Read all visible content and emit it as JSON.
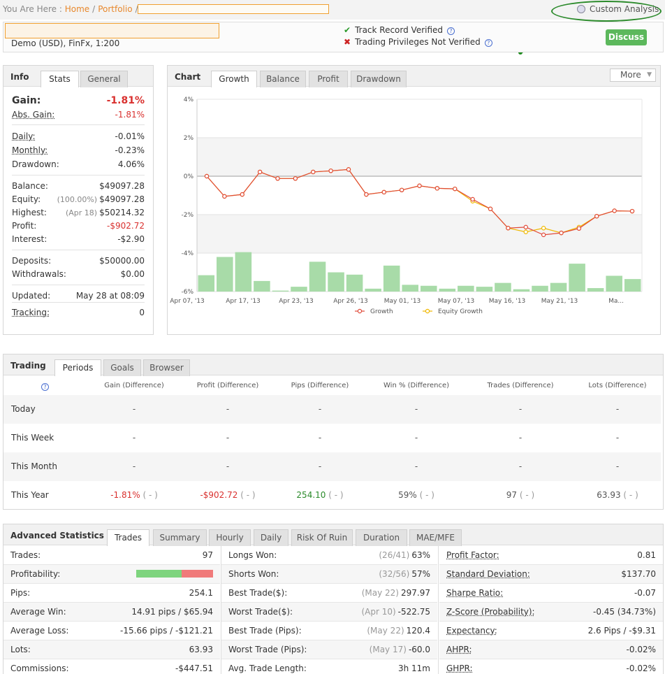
{
  "breadcrumb": {
    "prefix": "You Are Here :",
    "home": "Home",
    "portfolio": "Portfolio",
    "sep": "/"
  },
  "custom_analysis": "Custom Analysis",
  "account": {
    "info": "Demo (USD), FinFx, 1:200",
    "track_record": "Track Record Verified",
    "trading_privileges": "Trading Privileges Not Verified",
    "discuss_label": "Discuss",
    "help_glyph": "?"
  },
  "info_panel": {
    "title": "Info",
    "tabs": [
      "Stats",
      "General"
    ],
    "gain": {
      "label": "Gain:",
      "value": "-1.81%"
    },
    "abs_gain": {
      "label": "Abs. Gain:",
      "value": "-1.81%"
    },
    "daily": {
      "label": "Daily:",
      "value": "-0.01%"
    },
    "monthly": {
      "label": "Monthly:",
      "value": "-0.23%"
    },
    "drawdown": {
      "label": "Drawdown:",
      "value": "4.06%"
    },
    "balance": {
      "label": "Balance:",
      "value": "$49097.28"
    },
    "equity": {
      "label": "Equity:",
      "note": "(100.00%)",
      "value": "$49097.28"
    },
    "highest": {
      "label": "Highest:",
      "note": "(Apr 18)",
      "value": "$50214.32"
    },
    "profit": {
      "label": "Profit:",
      "value": "-$902.72"
    },
    "interest": {
      "label": "Interest:",
      "value": "-$2.90"
    },
    "deposits": {
      "label": "Deposits:",
      "value": "$50000.00"
    },
    "withdrawals": {
      "label": "Withdrawals:",
      "value": "$0.00"
    },
    "updated": {
      "label": "Updated:",
      "value": "May 28 at 08:09"
    },
    "tracking": {
      "label": "Tracking:",
      "value": "0"
    }
  },
  "chart_panel": {
    "title": "Chart",
    "tabs": [
      "Growth",
      "Balance",
      "Profit",
      "Drawdown"
    ],
    "more_label": "More"
  },
  "chart_data": {
    "type": "line",
    "y_ticks": [
      "4%",
      "2%",
      "0%",
      "-2%",
      "-4%",
      "-6%"
    ],
    "ylim": [
      -6,
      4
    ],
    "x_ticks": [
      "Apr 07, '13",
      "Apr 17, '13",
      "Apr 23, '13",
      "Apr 26, '13",
      "May 01, '13",
      "May 07, '13",
      "May 16, '13",
      "May 21, '13",
      "Ma..."
    ],
    "series": [
      {
        "name": "Growth",
        "color": "#e04a3a",
        "values": [
          0.0,
          -1.05,
          -0.95,
          0.22,
          -0.12,
          -0.12,
          0.22,
          0.28,
          0.35,
          -0.95,
          -0.83,
          -0.72,
          -0.5,
          -0.63,
          -0.66,
          -1.2,
          -1.7,
          -2.7,
          -2.65,
          -3.05,
          -2.95,
          -2.72,
          -2.08,
          -1.8,
          -1.82
        ]
      },
      {
        "name": "Equity Growth",
        "color": "#f0b800",
        "values": [
          0.0,
          -1.05,
          -0.95,
          0.22,
          -0.12,
          -0.12,
          0.22,
          0.28,
          0.35,
          -0.95,
          -0.83,
          -0.72,
          -0.5,
          -0.63,
          -0.66,
          -1.3,
          -1.7,
          -2.7,
          -2.9,
          -2.7,
          -2.95,
          -2.65,
          -2.08,
          -1.8,
          -1.82
        ]
      }
    ],
    "bars": [
      0.85,
      1.8,
      2.05,
      0.55,
      0.05,
      0.25,
      1.55,
      1.0,
      0.88,
      0.15,
      1.35,
      0.35,
      0.3,
      0.15,
      0.3,
      0.25,
      0.45,
      0.12,
      0.3,
      0.45,
      1.45,
      0.18,
      0.82,
      0.65
    ],
    "grid": true,
    "legend": "bottom"
  },
  "trading_panel": {
    "title": "Trading",
    "tabs": [
      "Periods",
      "Goals",
      "Browser"
    ],
    "headers": [
      "Gain (Difference)",
      "Profit (Difference)",
      "Pips (Difference)",
      "Win % (Difference)",
      "Trades (Difference)",
      "Lots (Difference)"
    ],
    "rows": [
      {
        "label": "Today",
        "cells": [
          "-",
          "-",
          "-",
          "-",
          "-",
          "-"
        ]
      },
      {
        "label": "This Week",
        "cells": [
          "-",
          "-",
          "-",
          "-",
          "-",
          "-"
        ]
      },
      {
        "label": "This Month",
        "cells": [
          "-",
          "-",
          "-",
          "-",
          "-",
          "-"
        ]
      },
      {
        "label": "This Year",
        "cells": [
          "-1.81%",
          "-$902.72",
          "254.10",
          "59%",
          "97",
          "63.93"
        ],
        "diff": "( - )"
      }
    ]
  },
  "advanced_panel": {
    "title": "Advanced Statistics",
    "tabs": [
      "Trades",
      "Summary",
      "Hourly",
      "Daily",
      "Risk Of Ruin",
      "Duration",
      "MAE/MFE"
    ],
    "col1": [
      {
        "label": "Trades:",
        "value": "97"
      },
      {
        "label": "Profitability:",
        "value": ""
      },
      {
        "label": "Pips:",
        "value": "254.1"
      },
      {
        "label": "Average Win:",
        "value": "14.91 pips / $65.94"
      },
      {
        "label": "Average Loss:",
        "value": "-15.66 pips / -$121.21"
      },
      {
        "label": "Lots:",
        "value": "63.93"
      },
      {
        "label": "Commissions:",
        "value": "-$447.51"
      }
    ],
    "profitability_win_fraction": 0.59,
    "col2": [
      {
        "label": "Longs Won:",
        "note": "(26/41)",
        "value": "63%"
      },
      {
        "label": "Shorts Won:",
        "note": "(32/56)",
        "value": "57%"
      },
      {
        "label": "Best Trade($):",
        "note": "(May 22)",
        "value": "297.97"
      },
      {
        "label": "Worst Trade($):",
        "note": "(Apr 10)",
        "value": "-522.75"
      },
      {
        "label": "Best Trade (Pips):",
        "note": "(May 22)",
        "value": "120.4"
      },
      {
        "label": "Worst Trade (Pips):",
        "note": "(May 17)",
        "value": "-60.0"
      },
      {
        "label": "Avg. Trade Length:",
        "note": "",
        "value": "3h 11m"
      }
    ],
    "col3": [
      {
        "label": "Profit Factor:",
        "value": "0.81"
      },
      {
        "label": "Standard Deviation:",
        "value": "$137.70"
      },
      {
        "label": "Sharpe Ratio:",
        "value": "-0.07"
      },
      {
        "label": "Z-Score (Probability):",
        "value": "-0.45 (34.73%)"
      },
      {
        "label": "Expectancy:",
        "value": "2.6 Pips / -$9.31"
      },
      {
        "label": "AHPR:",
        "value": "-0.02%"
      },
      {
        "label": "GHPR:",
        "value": "-0.02%"
      }
    ]
  },
  "colors": {
    "accent_orange": "#e8882c",
    "negative": "#d9312f",
    "positive": "#2a8a2a",
    "discuss_green": "#5cb85c",
    "bar_green": "#a8dba8"
  }
}
